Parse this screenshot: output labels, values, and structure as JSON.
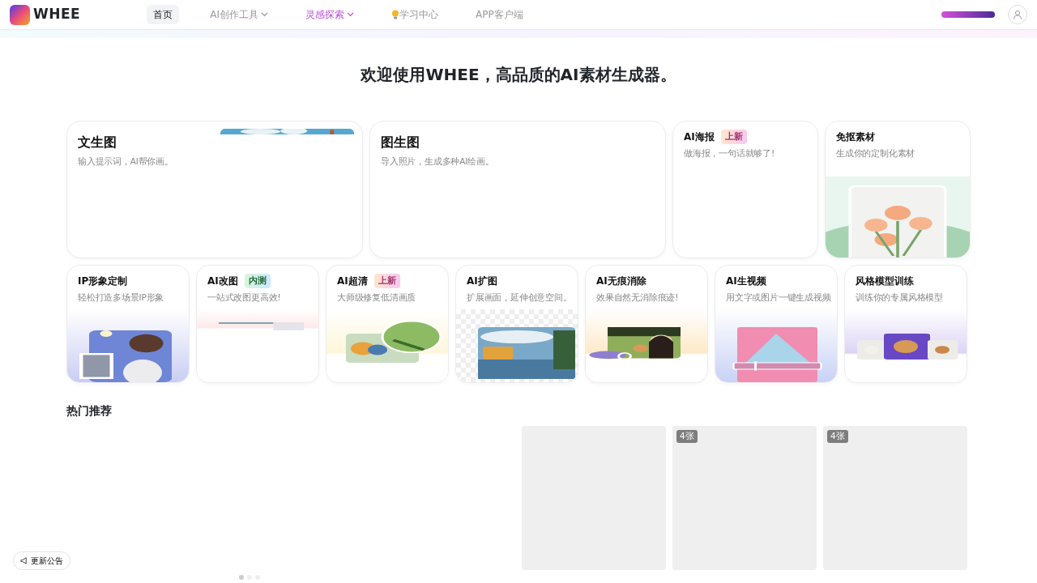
{
  "nav": {
    "logo_text": "WHEE",
    "items": [
      {
        "label": "首页",
        "selected": true,
        "menu": false,
        "kind": "plain"
      },
      {
        "label": "AI创作工具",
        "selected": false,
        "menu": true,
        "kind": "plain"
      },
      {
        "label": "灵感探索",
        "selected": false,
        "menu": true,
        "kind": "accent"
      },
      {
        "label": "学习中心",
        "selected": false,
        "menu": false,
        "kind": "bulb"
      },
      {
        "label": "APP客户端",
        "selected": false,
        "menu": false,
        "kind": "plain"
      }
    ]
  },
  "headline": "欢迎使用WHEE，高品质的AI素材生成器。",
  "feature_cards": [
    {
      "title": "文生图",
      "subtitle": "输入提示词，AI帮你画。",
      "picture": true
    },
    {
      "title": "图生图",
      "subtitle": "导入照片，生成多种AI绘画。",
      "picture": false
    },
    {
      "title": "AI海报",
      "subtitle": "做海报，一句话就够了!",
      "badge": {
        "text": "上新",
        "kind": "new"
      },
      "picture": false
    },
    {
      "title": "免抠素材",
      "subtitle": "生成你的定制化素材",
      "picture": true
    }
  ],
  "tool_cards": [
    {
      "title": "IP形象定制",
      "subtitle": "轻松打造多场景IP形象"
    },
    {
      "title": "AI改图",
      "subtitle": "一站式改图更高效!",
      "badge": {
        "text": "内测",
        "kind": "beta"
      }
    },
    {
      "title": "AI超清",
      "subtitle": "大师级修复低清画质",
      "badge": {
        "text": "上新",
        "kind": "new"
      }
    },
    {
      "title": "AI扩图",
      "subtitle": "扩展画面，延伸创意空间。"
    },
    {
      "title": "AI无痕消除",
      "subtitle": "效果自然无消除痕迹!"
    },
    {
      "title": "AI生视频",
      "subtitle": "用文字或图片一键生成视频"
    },
    {
      "title": "风格模型训练",
      "subtitle": "训练你的专属风格模型"
    }
  ],
  "recommend": {
    "title": "热门推荐",
    "carousel_dots": [
      {
        "selected": true
      },
      {
        "selected": false
      },
      {
        "selected": false
      }
    ],
    "tiles": [
      {
        "kind": "plain"
      },
      {
        "kind": "counted",
        "count": "4张"
      },
      {
        "kind": "counted",
        "count": "4张"
      }
    ]
  },
  "announcement": "更新公告"
}
